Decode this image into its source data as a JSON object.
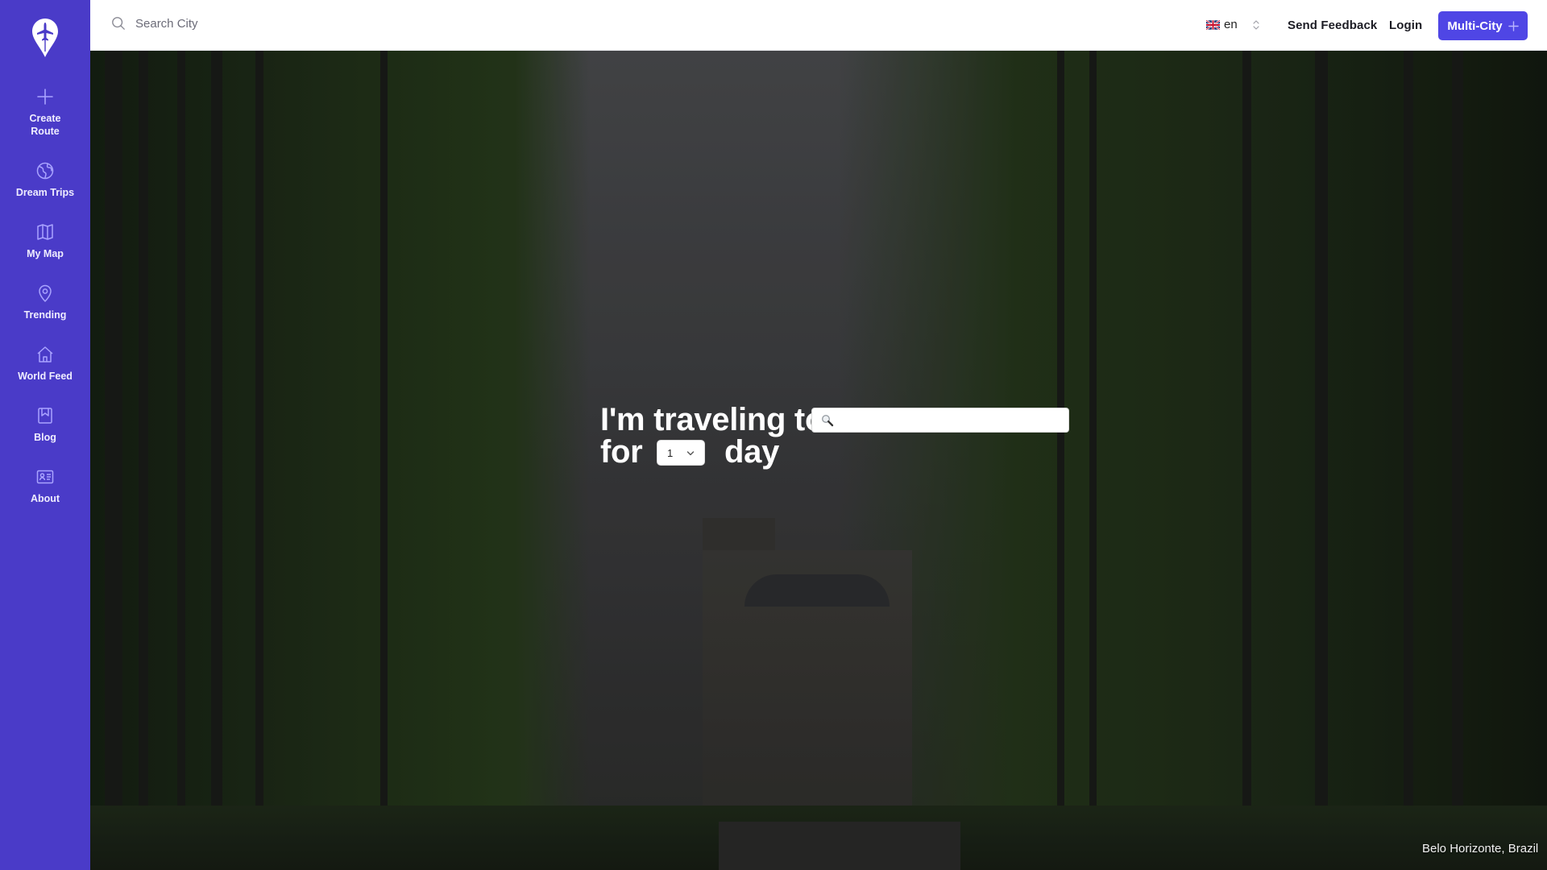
{
  "sidebar": {
    "logo": "plane-pin-logo",
    "items": [
      {
        "label": "Create\nRoute",
        "label_lines": [
          "Create",
          "Route"
        ],
        "icon": "plus-icon"
      },
      {
        "label": "Dream Trips",
        "icon": "globe-icon"
      },
      {
        "label": "My Map",
        "icon": "map-icon"
      },
      {
        "label": "Trending",
        "icon": "map-pin-icon"
      },
      {
        "label": "World Feed",
        "icon": "home-icon"
      },
      {
        "label": "Blog",
        "icon": "bookmark-book-icon"
      },
      {
        "label": "About",
        "icon": "id-card-icon"
      }
    ],
    "bg_color": "#4a3bc8"
  },
  "header": {
    "search": {
      "placeholder": "Search City",
      "value": ""
    },
    "language": {
      "flag": "uk-flag",
      "code": "en"
    },
    "send_feedback": "Send Feedback",
    "login": "Login",
    "multi_city": {
      "label": "Multi-City",
      "icon": "plus-icon",
      "color": "#4f46e5"
    }
  },
  "hero": {
    "line1": "I'm traveling to",
    "line2_prefix": "for",
    "line2_suffix": "day",
    "destination": {
      "placeholder": "",
      "value": "",
      "icon": "magnifier-icon"
    },
    "days": {
      "selected": "1"
    },
    "photo_caption": "Belo Horizonte, Brazil"
  }
}
